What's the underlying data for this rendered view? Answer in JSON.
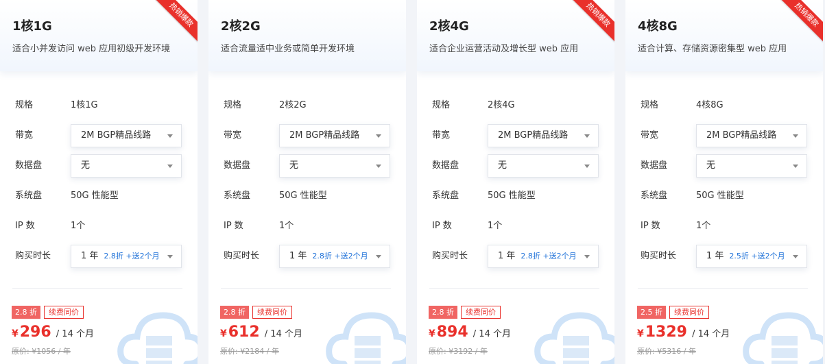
{
  "labels": {
    "spec": "规格",
    "bandwidth": "带宽",
    "data_disk": "数据盘",
    "system_disk": "系统盘",
    "ip": "IP 数",
    "duration": "购买时长",
    "renew_same": "续费同价",
    "original_prefix": "原价:",
    "hot_badge": "热销爆款"
  },
  "colors": {
    "accent_red": "#e9302b",
    "promo_blue": "#2173d9",
    "cloud_blue": "#c9e0f8"
  },
  "cards": [
    {
      "title": "1核1G",
      "desc": "适合小并发访问 web 应用初级开发环境",
      "hot": true,
      "spec": "1核1G",
      "bandwidth": "2M BGP精品线路",
      "data_disk": "无",
      "system_disk": "50G 性能型",
      "ip": "1个",
      "duration": "1 年",
      "duration_promo": "2.8折 +送2个月",
      "discount": "2.8 折",
      "currency": "¥",
      "price": "296",
      "price_unit": "/ 14 个月",
      "original": "¥1056 / 年"
    },
    {
      "title": "2核2G",
      "desc": "适合流量适中业务或简单开发环境",
      "hot": false,
      "spec": "2核2G",
      "bandwidth": "2M BGP精品线路",
      "data_disk": "无",
      "system_disk": "50G 性能型",
      "ip": "1个",
      "duration": "1 年",
      "duration_promo": "2.8折 +送2个月",
      "discount": "2.8 折",
      "currency": "¥",
      "price": "612",
      "price_unit": "/ 14 个月",
      "original": "¥2184 / 年"
    },
    {
      "title": "2核4G",
      "desc": "适合企业运营活动及增长型 web 应用",
      "hot": true,
      "spec": "2核4G",
      "bandwidth": "2M BGP精品线路",
      "data_disk": "无",
      "system_disk": "50G 性能型",
      "ip": "1个",
      "duration": "1 年",
      "duration_promo": "2.8折 +送2个月",
      "discount": "2.8 折",
      "currency": "¥",
      "price": "894",
      "price_unit": "/ 14 个月",
      "original": "¥3192 / 年"
    },
    {
      "title": "4核8G",
      "desc": "适合计算、存储资源密集型 web 应用",
      "hot": true,
      "spec": "4核8G",
      "bandwidth": "2M BGP精品线路",
      "data_disk": "无",
      "system_disk": "50G 性能型",
      "ip": "1个",
      "duration": "1 年",
      "duration_promo": "2.5折 +送2个月",
      "discount": "2.5 折",
      "currency": "¥",
      "price": "1329",
      "price_unit": "/ 14 个月",
      "original": "¥5316 / 年"
    }
  ]
}
